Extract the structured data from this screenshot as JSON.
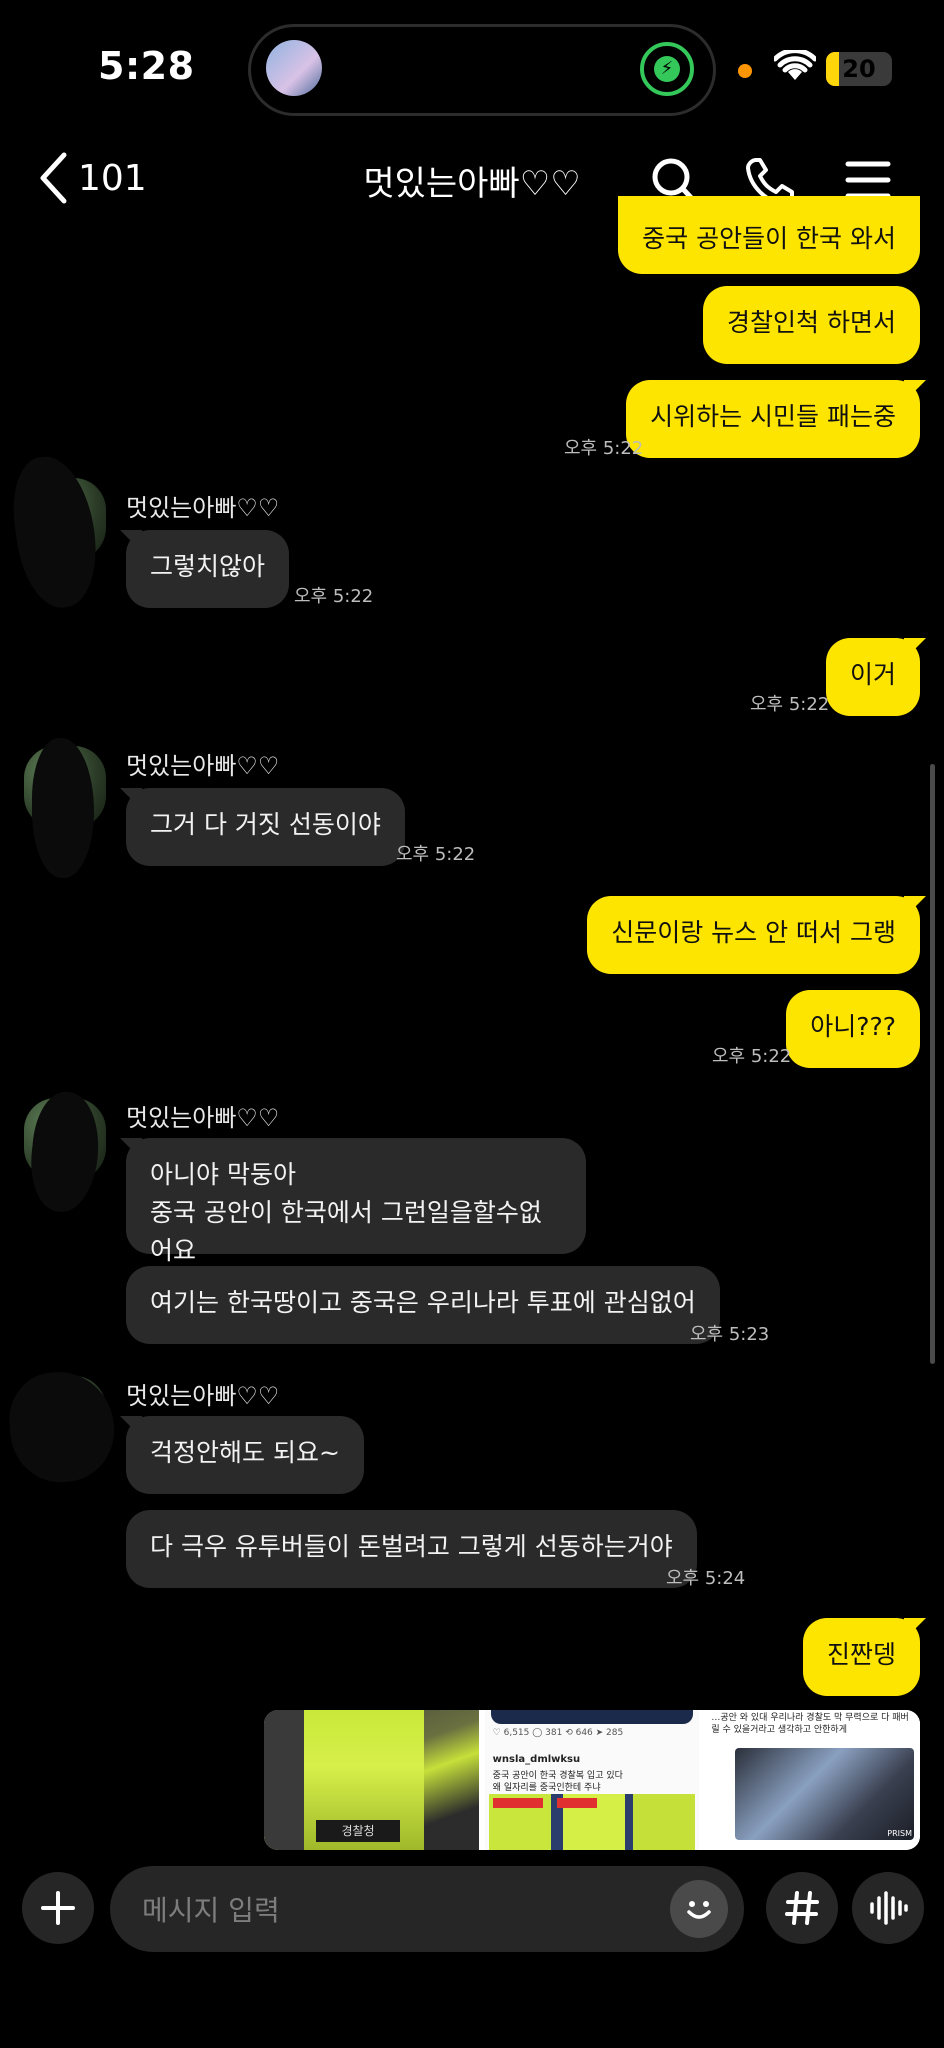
{
  "status_bar": {
    "time": "5:28",
    "battery": "20"
  },
  "header": {
    "back_count": "101",
    "title": "멋있는아빠♡♡"
  },
  "messages": {
    "m1": "중국 공안들이 한국 와서",
    "m2": "경찰인척 하면서",
    "m3": "시위하는 시민들 패는중",
    "t3": "오후 5:22",
    "s1": "멋있는아빠♡♡",
    "o1": "그렇치않아",
    "t4": "오후 5:22",
    "m4": "이거",
    "t5": "오후 5:22",
    "s2": "멋있는아빠♡♡",
    "o2": "그거 다 거짓 선동이야",
    "t6": "오후 5:22",
    "m5": "신문이랑 뉴스 안 떠서 그랭",
    "m6": "아니???",
    "t7": "오후 5:22",
    "s3": "멋있는아빠♡♡",
    "o3a": "아니야 막둥아",
    "o3b": "중국  공안이 한국에서 그런일을할수없어요",
    "o4": "여기는 한국땅이고 중국은 우리나라 투표에 관심없어",
    "t8": "오후 5:23",
    "s4": "멋있는아빠♡♡",
    "o5": "걱정안해도 되요~",
    "o6": "다 극우 유투버들이 돈벌려고 그렇게 선동하는거야",
    "t9": "오후 5:24",
    "m7": "진짠뎅"
  },
  "image_strip": {
    "img1_badge": "경찰청",
    "img2_user": "wnsla_dmlwksu",
    "img2_text": "중국 공안이 한국 경찰복 입고 있다",
    "img2_text2": "왜 일자리를 중국인한테 주냐",
    "img2_stats": "♡ 6,515  ◯ 381  ⟲ 646  ➤ 285",
    "img3_text": "…공안 와 있대 우리나라 경찰도 막 무력으로 다 패버릴 수 있을거라고 생각하고 안한하게",
    "img3_brand": "PRISM"
  },
  "input": {
    "placeholder": "메시지 입력"
  },
  "icons": {
    "back": "chevron-left-icon",
    "search": "search-icon",
    "call": "phone-icon",
    "menu": "hamburger-menu-icon",
    "add": "plus-icon",
    "emoji": "emoji-icon",
    "hashtag": "hashtag-icon",
    "voice": "voice-icon"
  },
  "colors": {
    "my_bubble": "#fee500",
    "other_bubble": "#2a2a2a",
    "background": "#000000"
  }
}
